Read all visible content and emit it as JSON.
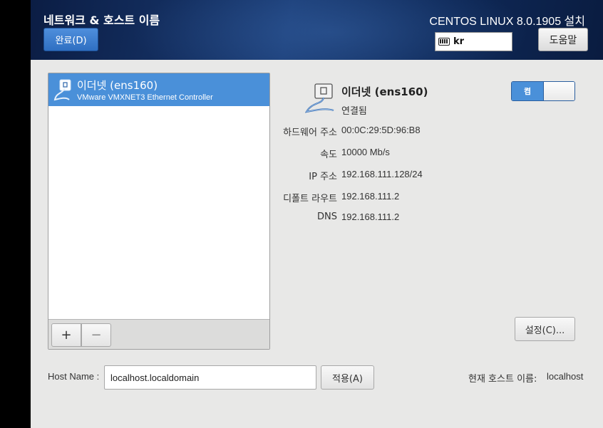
{
  "header": {
    "title": "네트워크 & 호스트 이름",
    "done_label": "완료(D)",
    "product_title": "CENTOS LINUX 8.0.1905 설치",
    "keyboard_layout": "kr",
    "help_label": "도움말"
  },
  "devices": {
    "items": [
      {
        "name": "이더넷 (ens160)",
        "description": "VMware VMXNET3 Ethernet Controller",
        "selected": true
      }
    ],
    "add_label": "+",
    "remove_label": "−"
  },
  "detail": {
    "name": "이더넷 (ens160)",
    "status": "연결됨",
    "toggle_label": "켬",
    "toggle_on": true,
    "rows": [
      {
        "label": "하드웨어 주소",
        "value": "00:0C:29:5D:96:B8"
      },
      {
        "label": "속도",
        "value": "10000 Mb/s"
      },
      {
        "label": "IP 주소",
        "value": "192.168.111.128/24"
      },
      {
        "label": "디폴트 라우트",
        "value": "192.168.111.2"
      },
      {
        "label": "DNS",
        "value": "192.168.111.2"
      }
    ],
    "settings_label": "설정(C)..."
  },
  "hostname": {
    "label": "Host Name :",
    "value": "localhost.localdomain",
    "apply_label": "적용(A)",
    "current_label": "현재 호스트 이름:",
    "current_value": "localhost"
  },
  "colors": {
    "accent": "#4a90d9",
    "header_bg": "#12306a"
  }
}
